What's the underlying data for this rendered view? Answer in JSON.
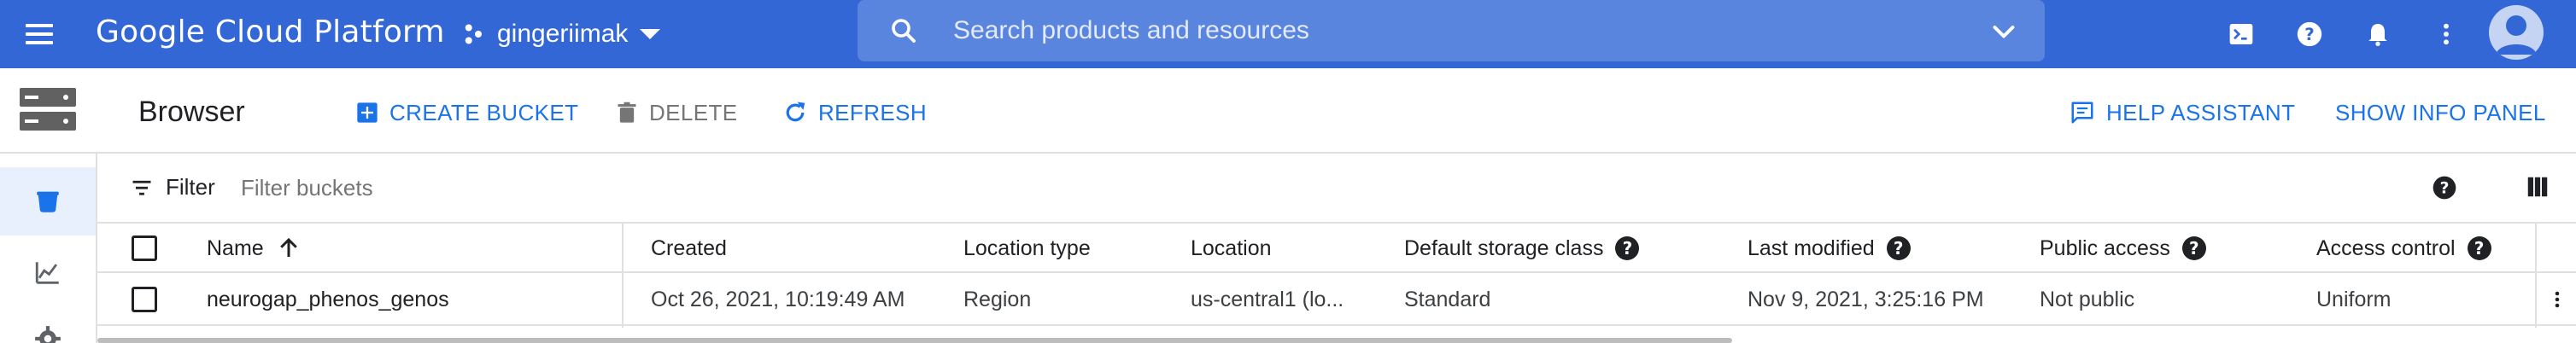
{
  "topbar": {
    "brand": "Google Cloud Platform",
    "project": "gingeriimak",
    "search_placeholder": "Search products and resources",
    "icons": [
      "menu-icon",
      "project-icon",
      "search-icon",
      "chevron-down-icon",
      "cloud-shell-icon",
      "help-icon",
      "notifications-icon",
      "more-vert-icon",
      "account-avatar"
    ]
  },
  "rail": {
    "items": [
      "storage-product-icon",
      "bucket-icon",
      "monitoring-icon",
      "settings-icon"
    ]
  },
  "toolbar": {
    "title": "Browser",
    "create_bucket": "CREATE BUCKET",
    "delete": "DELETE",
    "refresh": "REFRESH",
    "help_assistant": "HELP ASSISTANT",
    "show_info_panel": "SHOW INFO PANEL"
  },
  "filter": {
    "label": "Filter",
    "placeholder": "Filter buckets"
  },
  "table": {
    "columns": {
      "name": "Name",
      "created": "Created",
      "location_type": "Location type",
      "location": "Location",
      "storage_class": "Default storage class",
      "last_modified": "Last modified",
      "public_access": "Public access",
      "access_control": "Access control"
    },
    "rows": [
      {
        "name": "neurogap_phenos_genos",
        "created": "Oct 26, 2021, 10:19:49 AM",
        "location_type": "Region",
        "location": "us-central1 (lo...",
        "storage_class": "Standard",
        "last_modified": "Nov 9, 2021, 3:25:16 PM",
        "public_access": "Not public",
        "access_control": "Uniform"
      }
    ],
    "sort": "ascending"
  },
  "colors": {
    "topbar": "#3367d6",
    "search_bg": "#5a85de",
    "accent": "#1a73e8",
    "rail_active": "#e8f0fe"
  }
}
